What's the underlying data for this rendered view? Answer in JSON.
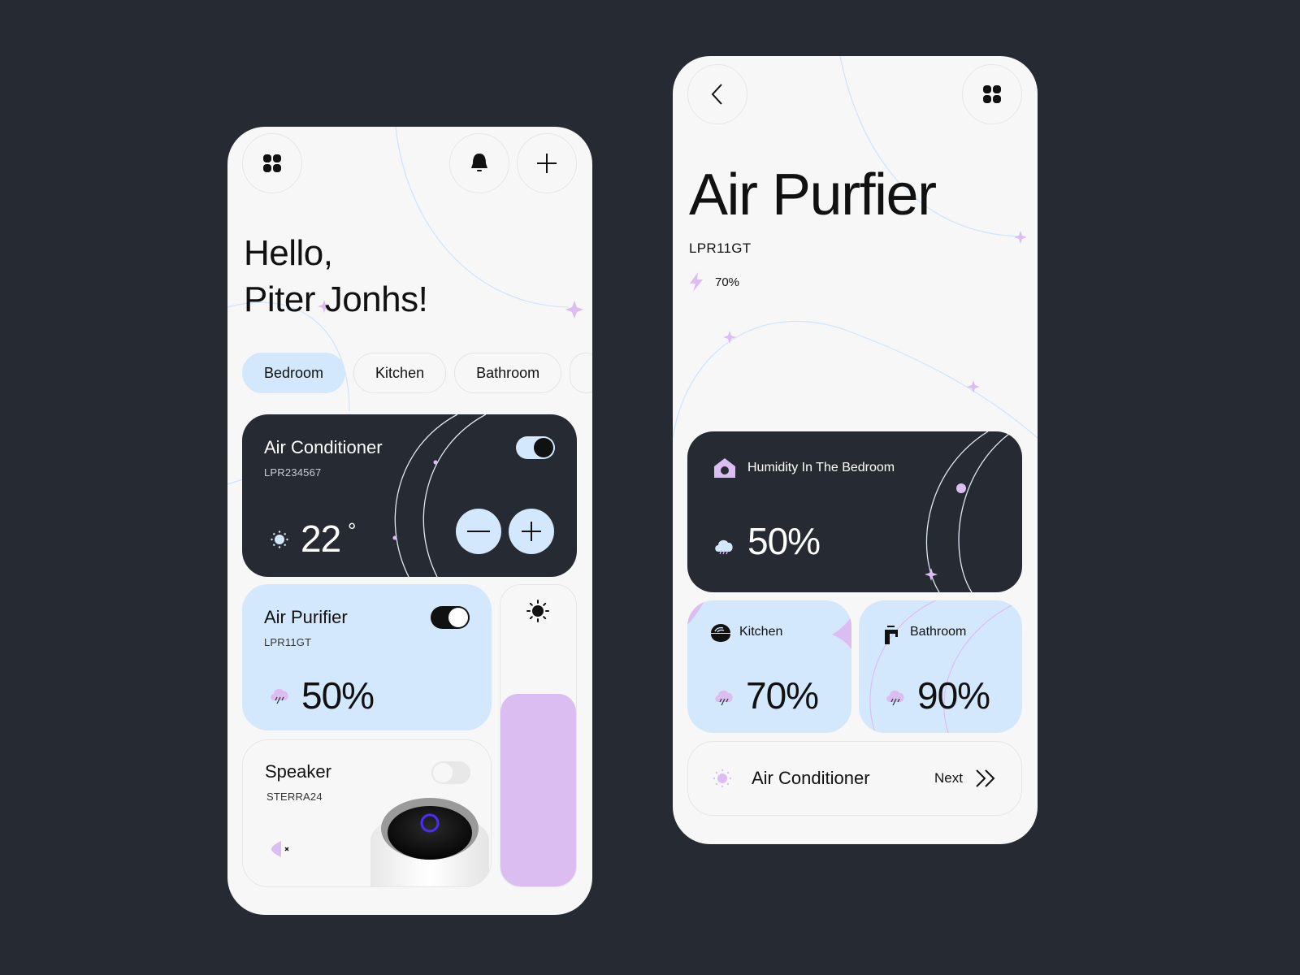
{
  "home": {
    "header": {
      "menu_icon": "grid-icon",
      "notification_icon": "bell-icon",
      "add_icon": "plus-icon"
    },
    "greeting": {
      "hello": "Hello,",
      "name": "Piter Jonhs!"
    },
    "rooms": [
      {
        "label": "Bedroom",
        "active": true
      },
      {
        "label": "Kitchen",
        "active": false
      },
      {
        "label": "Bathroom",
        "active": false
      }
    ],
    "air_conditioner": {
      "title": "Air Conditioner",
      "model": "LPR234567",
      "on": true,
      "temperature": "22",
      "unit": "°",
      "decrease_icon": "minus-icon",
      "increase_icon": "plus-icon"
    },
    "air_purifier": {
      "title": "Air Purifier",
      "model": "LPR11GT",
      "on": true,
      "value": "50%"
    },
    "brightness": {
      "icon": "sun-icon",
      "level_fraction": 0.64
    },
    "speaker": {
      "title": "Speaker",
      "model": "STERRA24",
      "on": false,
      "muted": true
    }
  },
  "detail": {
    "header": {
      "back_icon": "chevron-left-icon",
      "menu_icon": "grid-icon"
    },
    "title": "Air Purfier",
    "model": "LPR11GT",
    "battery": "70%",
    "humidity_card": {
      "title": "Humidity In The Bedroom",
      "value": "50%"
    },
    "rooms": [
      {
        "label": "Kitchen",
        "value": "70%",
        "icon": "bowl-icon"
      },
      {
        "label": "Bathroom",
        "value": "90%",
        "icon": "faucet-icon"
      }
    ],
    "next": {
      "device": "Air Conditioner",
      "label": "Next"
    }
  },
  "colors": {
    "background": "#262b33",
    "surface": "#f7f7f7",
    "accent_blue": "#d3e8fd",
    "accent_purple": "#dcbdf2",
    "dark_card": "#262b33"
  }
}
